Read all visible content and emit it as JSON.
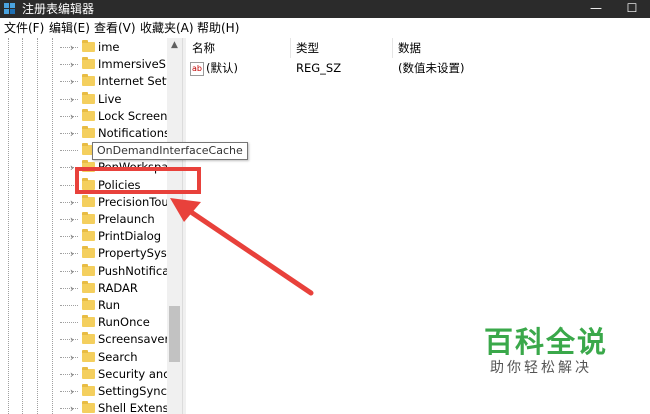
{
  "window": {
    "title": "注册表编辑器",
    "minimize_glyph": "—",
    "maximize_glyph": "☐"
  },
  "menu": [
    "文件(F)",
    "编辑(E)",
    "查看(V)",
    "收藏夹(A)",
    "帮助(H)"
  ],
  "tree": {
    "items": [
      {
        "label": "ime",
        "expandable": true
      },
      {
        "label": "ImmersiveShe",
        "expandable": true
      },
      {
        "label": "Internet Settir",
        "expandable": true
      },
      {
        "label": "Live",
        "expandable": true
      },
      {
        "label": "Lock Screen",
        "expandable": true
      },
      {
        "label": "Notifications",
        "expandable": true
      },
      {
        "label": "",
        "expandable": false
      },
      {
        "label": "PenWorkspac",
        "expandable": true
      },
      {
        "label": "Policies",
        "expandable": false,
        "highlighted": true
      },
      {
        "label": "PrecisionTouc",
        "expandable": true
      },
      {
        "label": "Prelaunch",
        "expandable": true
      },
      {
        "label": "PrintDialog",
        "expandable": true
      },
      {
        "label": "PropertySyste",
        "expandable": true
      },
      {
        "label": "PushNotificati",
        "expandable": true
      },
      {
        "label": "RADAR",
        "expandable": true
      },
      {
        "label": "Run",
        "expandable": false
      },
      {
        "label": "RunOnce",
        "expandable": false
      },
      {
        "label": "Screensavers",
        "expandable": true
      },
      {
        "label": "Search",
        "expandable": true
      },
      {
        "label": "Security and I",
        "expandable": true
      },
      {
        "label": "SettingSync",
        "expandable": true
      },
      {
        "label": "Shell Extensio",
        "expandable": true
      }
    ],
    "tooltip": "OnDemandInterfaceCache"
  },
  "values": {
    "headers": {
      "name": "名称",
      "type": "类型",
      "data": "数据"
    },
    "rows": [
      {
        "icon": "ab",
        "name": "(默认)",
        "type": "REG_SZ",
        "data": "(数值未设置)"
      }
    ]
  },
  "watermark": {
    "title": "百科全说",
    "subtitle": "助你轻松解决"
  },
  "colors": {
    "titlebar": "#2b2b2b",
    "folder": "#f4cf5e",
    "annotation_red": "#e8413b",
    "watermark_green": "#3aa84a"
  }
}
